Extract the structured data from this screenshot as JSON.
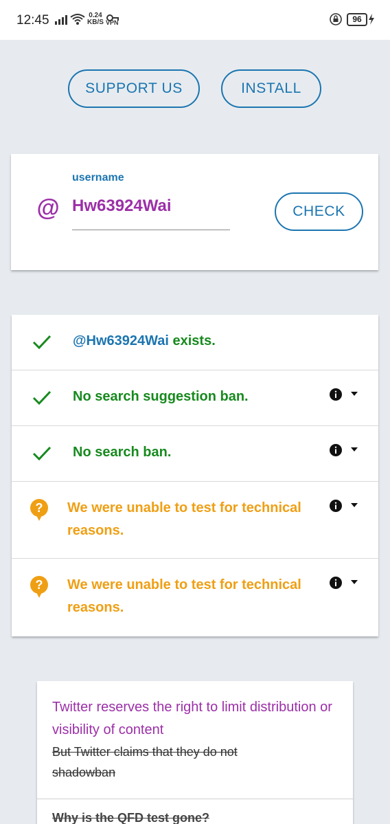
{
  "status_bar": {
    "time": "12:45",
    "speed_value": "0.24",
    "speed_unit": "KB/S",
    "vpn_label": "VPN",
    "battery": "96"
  },
  "header": {
    "support_label": "SUPPORT US",
    "install_label": "INSTALL"
  },
  "username_form": {
    "label": "username",
    "at_symbol": "@",
    "value": "Hw63924Wai",
    "check_label": "CHECK"
  },
  "results": [
    {
      "status": "ok",
      "text_highlight": "@Hw63924Wai",
      "text": " exists.",
      "has_info": false
    },
    {
      "status": "ok",
      "text": "No search suggestion ban.",
      "has_info": true
    },
    {
      "status": "ok",
      "text": "No search ban.",
      "has_info": true
    },
    {
      "status": "unknown",
      "text": "We were unable to test for technical reasons.",
      "has_info": true
    },
    {
      "status": "unknown",
      "text": "We were unable to test for technical reasons.",
      "has_info": true
    }
  ],
  "info_card": {
    "title": "Twitter reserves the right to limit distribution or visibility of content",
    "strike_text": "But Twitter claims that they do not shadowban",
    "next_item": "Why is the QFD test gone?"
  },
  "colors": {
    "accent_blue": "#1b75b0",
    "purple": "#9c2fa8",
    "ok_green": "#178a1e",
    "warn_orange": "#ef9f14",
    "background": "#e7ebef"
  },
  "icons": {
    "ok": "check-icon",
    "unknown": "question-bubble-icon",
    "info": "info-icon",
    "expand": "caret-down-icon"
  }
}
